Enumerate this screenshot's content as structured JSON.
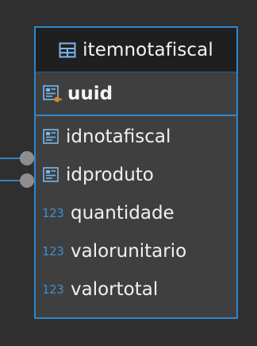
{
  "entity": {
    "title": "itemnotafiscal",
    "pk": {
      "label": "uuid"
    },
    "fields": [
      {
        "label": "idnotafiscal",
        "type": "fk",
        "icon": "foreign-key-icon"
      },
      {
        "label": "idproduto",
        "type": "fk",
        "icon": "foreign-key-icon"
      },
      {
        "label": "quantidade",
        "type": "numeric",
        "icon": "numeric-icon",
        "icon_text": "123"
      },
      {
        "label": "valorunitario",
        "type": "numeric",
        "icon": "numeric-icon",
        "icon_text": "123"
      },
      {
        "label": "valortotal",
        "type": "numeric",
        "icon": "numeric-icon",
        "icon_text": "123"
      }
    ]
  },
  "colors": {
    "background": "#2f2f2f",
    "entity_background": "#3f3f3f",
    "header_background": "#1f1f1f",
    "border": "#2f86cc",
    "connector": "#3a7fb8",
    "text": "#f4f4f4",
    "numeric_icon": "#3d8fd1"
  }
}
